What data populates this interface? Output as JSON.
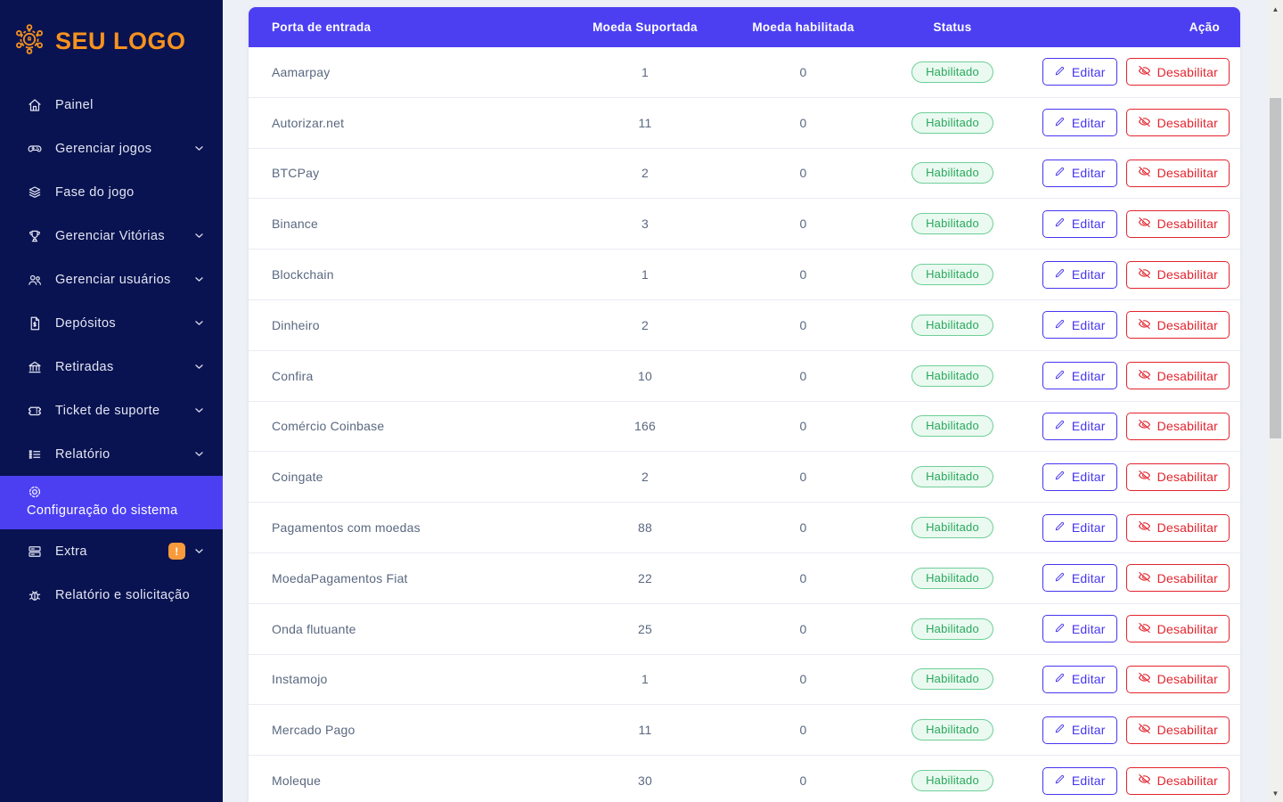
{
  "colors": {
    "navy": "#0a1351",
    "indigo": "#4c3ff2",
    "orange": "#f6921e",
    "badge_orange": "#f89b3c",
    "green": "#2aa85c",
    "edit": "#4636ef",
    "danger": "#e3242e",
    "bg": "#eef0f8"
  },
  "logo": {
    "text": "SEU LOGO"
  },
  "sidebar": {
    "items": [
      {
        "label": "Painel",
        "icon": "home-icon",
        "chevron": false,
        "active": false
      },
      {
        "label": "Gerenciar jogos",
        "icon": "gamepad-icon",
        "chevron": true,
        "active": false
      },
      {
        "label": "Fase do jogo",
        "icon": "layers-icon",
        "chevron": false,
        "active": false
      },
      {
        "label": "Gerenciar Vitórias",
        "icon": "trophy-icon",
        "chevron": true,
        "active": false
      },
      {
        "label": "Gerenciar usuários",
        "icon": "users-icon",
        "chevron": true,
        "active": false
      },
      {
        "label": "Depósitos",
        "icon": "file-dollar-icon",
        "chevron": true,
        "active": false
      },
      {
        "label": "Retiradas",
        "icon": "bank-icon",
        "chevron": true,
        "active": false
      },
      {
        "label": "Ticket de suporte",
        "icon": "ticket-icon",
        "chevron": true,
        "active": false
      },
      {
        "label": "Relatório",
        "icon": "list-icon",
        "chevron": true,
        "active": false
      },
      {
        "label": "Configuração do sistema",
        "icon": "gear-icon",
        "chevron": false,
        "active": true
      },
      {
        "label": "Extra",
        "icon": "server-icon",
        "chevron": true,
        "active": false,
        "badge": "!"
      },
      {
        "label": "Relatório e solicitação",
        "icon": "bug-icon",
        "chevron": false,
        "active": false
      }
    ]
  },
  "table": {
    "headers": [
      "Porta de entrada",
      "Moeda Suportada",
      "Moeda habilitada",
      "Status",
      "Ação"
    ],
    "edit_label": "Editar",
    "disable_label": "Desabilitar",
    "rows": [
      {
        "name": "Aamarpay",
        "supported": "1",
        "enabled": "0",
        "status": "Habilitado"
      },
      {
        "name": "Autorizar.net",
        "supported": "11",
        "enabled": "0",
        "status": "Habilitado"
      },
      {
        "name": "BTCPay",
        "supported": "2",
        "enabled": "0",
        "status": "Habilitado"
      },
      {
        "name": "Binance",
        "supported": "3",
        "enabled": "0",
        "status": "Habilitado"
      },
      {
        "name": "Blockchain",
        "supported": "1",
        "enabled": "0",
        "status": "Habilitado"
      },
      {
        "name": "Dinheiro",
        "supported": "2",
        "enabled": "0",
        "status": "Habilitado"
      },
      {
        "name": "Confira",
        "supported": "10",
        "enabled": "0",
        "status": "Habilitado"
      },
      {
        "name": "Comércio Coinbase",
        "supported": "166",
        "enabled": "0",
        "status": "Habilitado"
      },
      {
        "name": "Coingate",
        "supported": "2",
        "enabled": "0",
        "status": "Habilitado"
      },
      {
        "name": "Pagamentos com moedas",
        "supported": "88",
        "enabled": "0",
        "status": "Habilitado"
      },
      {
        "name": "MoedaPagamentos Fiat",
        "supported": "22",
        "enabled": "0",
        "status": "Habilitado"
      },
      {
        "name": "Onda flutuante",
        "supported": "25",
        "enabled": "0",
        "status": "Habilitado"
      },
      {
        "name": "Instamojo",
        "supported": "1",
        "enabled": "0",
        "status": "Habilitado"
      },
      {
        "name": "Mercado Pago",
        "supported": "11",
        "enabled": "0",
        "status": "Habilitado"
      },
      {
        "name": "Moleque",
        "supported": "30",
        "enabled": "0",
        "status": "Habilitado"
      }
    ]
  },
  "scrollbar": {
    "up_glyph": "▲",
    "down_glyph": "▼"
  }
}
